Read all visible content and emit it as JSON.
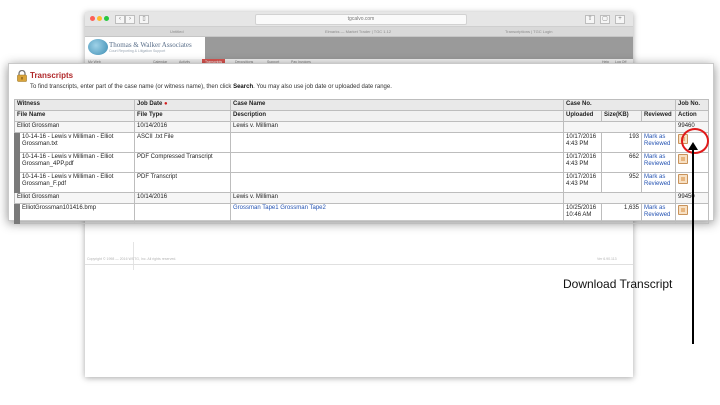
{
  "browser": {
    "url": "tgcalvo.com",
    "tabs": [
      "Untitled",
      "Elmarks — Market Trader | TGC 1.12",
      "Transcriptions | TGC Login"
    ],
    "logo": {
      "title": "Thomas & Walker Associates",
      "subtitle": "Court Reporting & Litigation Support"
    },
    "nav": [
      "My Web",
      "Calendar",
      "Activity",
      "Transcripts",
      "Depositions",
      "Support",
      "Pay Invoices"
    ],
    "nav_right": [
      "Help",
      "Log Off"
    ],
    "footer_left": "Copyright © 1998 — 2016 WSTG, Inc. All rights reserved.",
    "footer_right": "Ver 6.90.113"
  },
  "panel": {
    "title": "Transcripts",
    "instruction_before": "To find transcripts, enter part of the case name (or witness name), then click ",
    "instruction_bold": "Search",
    "instruction_after": ". You may also use job date or uploaded date range."
  },
  "table": {
    "header1": {
      "witness": "Witness",
      "job_date": "Job Date",
      "job_date_mark": "●",
      "case_name": "Case Name",
      "case_no": "Case No.",
      "job_no": "Job No."
    },
    "header2": {
      "file_name": "File Name",
      "file_type": "File Type",
      "description": "Description",
      "uploaded": "Uploaded",
      "size": "Size(KB)",
      "reviewed": "Reviewed",
      "action": "Action"
    },
    "groups": [
      {
        "witness": "Elliot Grossman",
        "job_date": "10/14/2016",
        "case_name": "Lewis v. Milliman",
        "job_no": "99460",
        "files": [
          {
            "name": "10-14-16 - Lewis v Milliman - Elliot Grossman.txt",
            "type": "ASCII .txt File",
            "description": "",
            "uploaded": "10/17/2016 4:43 PM",
            "size": "193",
            "reviewed": "Mark as Reviewed"
          },
          {
            "name": "10-14-16 - Lewis v Milliman - Elliot Grossman_4PP.pdf",
            "type": "PDF Compressed Transcript",
            "description": "",
            "uploaded": "10/17/2016 4:43 PM",
            "size": "662",
            "reviewed": "Mark as Reviewed"
          },
          {
            "name": "10-14-16 - Lewis v Milliman - Elliot Grossman_F.pdf",
            "type": "PDF Transcript",
            "description": "",
            "uploaded": "10/17/2016 4:43 PM",
            "size": "952",
            "reviewed": "Mark as Reviewed"
          }
        ]
      },
      {
        "witness": "Elliot Grossman",
        "job_date": "10/14/2016",
        "case_name": "Lewis v. Milliman",
        "job_no": "99450",
        "files": [
          {
            "name": "ElliotGrossman101416.bmp",
            "type": "",
            "description": "Grossman Tape1 Grossman Tape2",
            "uploaded": "10/25/2016 10:46 AM",
            "size": "1,635",
            "reviewed": "Mark as Reviewed"
          }
        ]
      }
    ]
  },
  "annotation": {
    "caption": "Download Transcript",
    "highlight_color": "#e01a1a"
  }
}
